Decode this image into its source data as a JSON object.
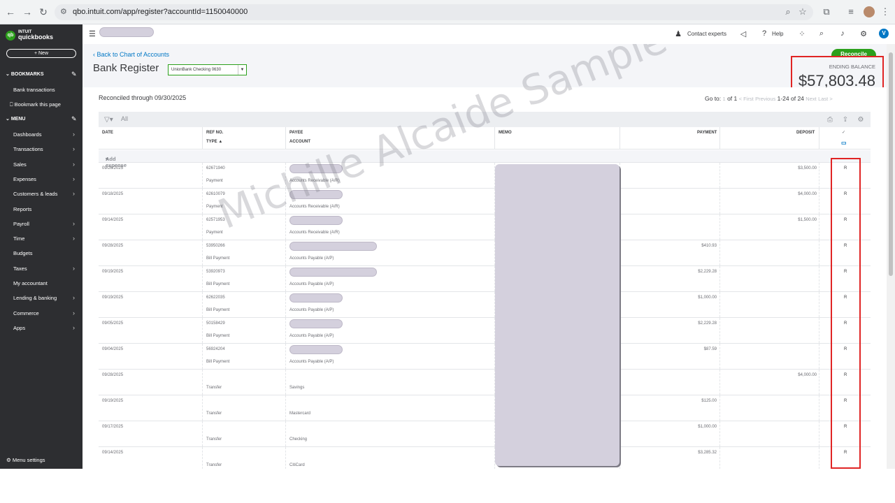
{
  "browser": {
    "url": "qbo.intuit.com/app/register?accountId=1150040000"
  },
  "sidebar": {
    "logo_top": "INTUIT",
    "logo_bottom": "quickbooks",
    "new_label": "+ New",
    "bookmarks_heading": "BOOKMARKS",
    "bookmarks": [
      "Bank transactions",
      "Bookmark this page"
    ],
    "menu_heading": "MENU",
    "menu_items": [
      {
        "label": "Dashboards",
        "chevron": true
      },
      {
        "label": "Transactions",
        "chevron": true
      },
      {
        "label": "Sales",
        "chevron": true
      },
      {
        "label": "Expenses",
        "chevron": true
      },
      {
        "label": "Customers & leads",
        "chevron": true
      },
      {
        "label": "Reports",
        "chevron": false
      },
      {
        "label": "Payroll",
        "chevron": true
      },
      {
        "label": "Time",
        "chevron": true
      },
      {
        "label": "Budgets",
        "chevron": false
      },
      {
        "label": "Taxes",
        "chevron": true
      },
      {
        "label": "My accountant",
        "chevron": false
      },
      {
        "label": "Lending & banking",
        "chevron": true
      },
      {
        "label": "Commerce",
        "chevron": true
      },
      {
        "label": "Apps",
        "chevron": true
      }
    ],
    "menu_settings": "Menu settings"
  },
  "header": {
    "contact_experts": "Contact experts",
    "help": "Help",
    "avatar_letter": "V"
  },
  "page": {
    "back_link": "Back to Chart of Accounts",
    "title": "Bank Register",
    "account_select": "UnionBank Checking 0630",
    "reconcile_button": "Reconcile",
    "ending_balance_label": "ENDING BALANCE",
    "ending_balance_value": "$57,803.48",
    "reconciled_through": "Reconciled through 09/30/2025",
    "pager": {
      "goto_label": "Go to:",
      "page_current": "1",
      "page_total": "of 1",
      "first": "< First",
      "previous": "Previous",
      "range": "1-24 of 24",
      "next": "Next",
      "last": "Last >"
    },
    "filter_label": "All",
    "add_expense": "Add expense",
    "watermark": "Michille Alcaide Sample Work"
  },
  "table": {
    "headers": {
      "date": "DATE",
      "ref_no": "REF NO.",
      "type": "TYPE",
      "payee": "PAYEE",
      "account": "ACCOUNT",
      "memo": "MEMO",
      "payment": "PAYMENT",
      "deposit": "DEPOSIT"
    },
    "rows": [
      {
        "date": "09/26/2025",
        "ref": "62671940",
        "type": "Payment",
        "account": "Accounts Receivable (A/R)",
        "payment": "",
        "deposit": "$3,500.00",
        "status": "R",
        "pill_w": 76
      },
      {
        "date": "09/18/2025",
        "ref": "62610079",
        "type": "Payment",
        "account": "Accounts Receivable (A/R)",
        "payment": "",
        "deposit": "$4,000.00",
        "status": "R",
        "pill_w": 76
      },
      {
        "date": "09/14/2025",
        "ref": "62571953",
        "type": "Payment",
        "account": "Accounts Receivable (A/R)",
        "payment": "",
        "deposit": "$1,500.00",
        "status": "R",
        "pill_w": 76
      },
      {
        "date": "09/28/2025",
        "ref": "53950266",
        "type": "Bill Payment",
        "account": "Accounts Payable (A/P)",
        "payment": "$410.93",
        "deposit": "",
        "status": "R",
        "pill_w": 125
      },
      {
        "date": "09/19/2025",
        "ref": "53920973",
        "type": "Bill Payment",
        "account": "Accounts Payable (A/P)",
        "payment": "$2,229.28",
        "deposit": "",
        "status": "R",
        "pill_w": 125
      },
      {
        "date": "09/19/2025",
        "ref": "62622035",
        "type": "Bill Payment",
        "account": "Accounts Payable (A/P)",
        "payment": "$1,000.00",
        "deposit": "",
        "status": "R",
        "pill_w": 76
      },
      {
        "date": "09/05/2025",
        "ref": "50158429",
        "type": "Bill Payment",
        "account": "Accounts Payable (A/P)",
        "payment": "$2,229.28",
        "deposit": "",
        "status": "R",
        "pill_w": 76
      },
      {
        "date": "09/04/2025",
        "ref": "56924204",
        "type": "Bill Payment",
        "account": "Accounts Payable (A/P)",
        "payment": "$87.59",
        "deposit": "",
        "status": "R",
        "pill_w": 76
      },
      {
        "date": "09/28/2025",
        "ref": "",
        "type": "Transfer",
        "account": "Savings",
        "payment": "",
        "deposit": "$4,000.00",
        "status": "R",
        "pill_w": 0
      },
      {
        "date": "09/19/2025",
        "ref": "",
        "type": "Transfer",
        "account": "Mastercard",
        "payment": "$125.00",
        "deposit": "",
        "status": "R",
        "pill_w": 0
      },
      {
        "date": "09/17/2025",
        "ref": "",
        "type": "Transfer",
        "account": "Checking",
        "payment": "$1,000.00",
        "deposit": "",
        "status": "R",
        "pill_w": 0
      },
      {
        "date": "09/14/2025",
        "ref": "",
        "type": "Transfer",
        "account": "CitiCard",
        "payment": "$3,285.32",
        "deposit": "",
        "status": "R",
        "pill_w": 0
      }
    ]
  },
  "colors": {
    "brand_green": "#2ca01c",
    "link_blue": "#0077c5",
    "highlight_red": "#e02424",
    "sidebar_bg": "#2d2e31"
  }
}
